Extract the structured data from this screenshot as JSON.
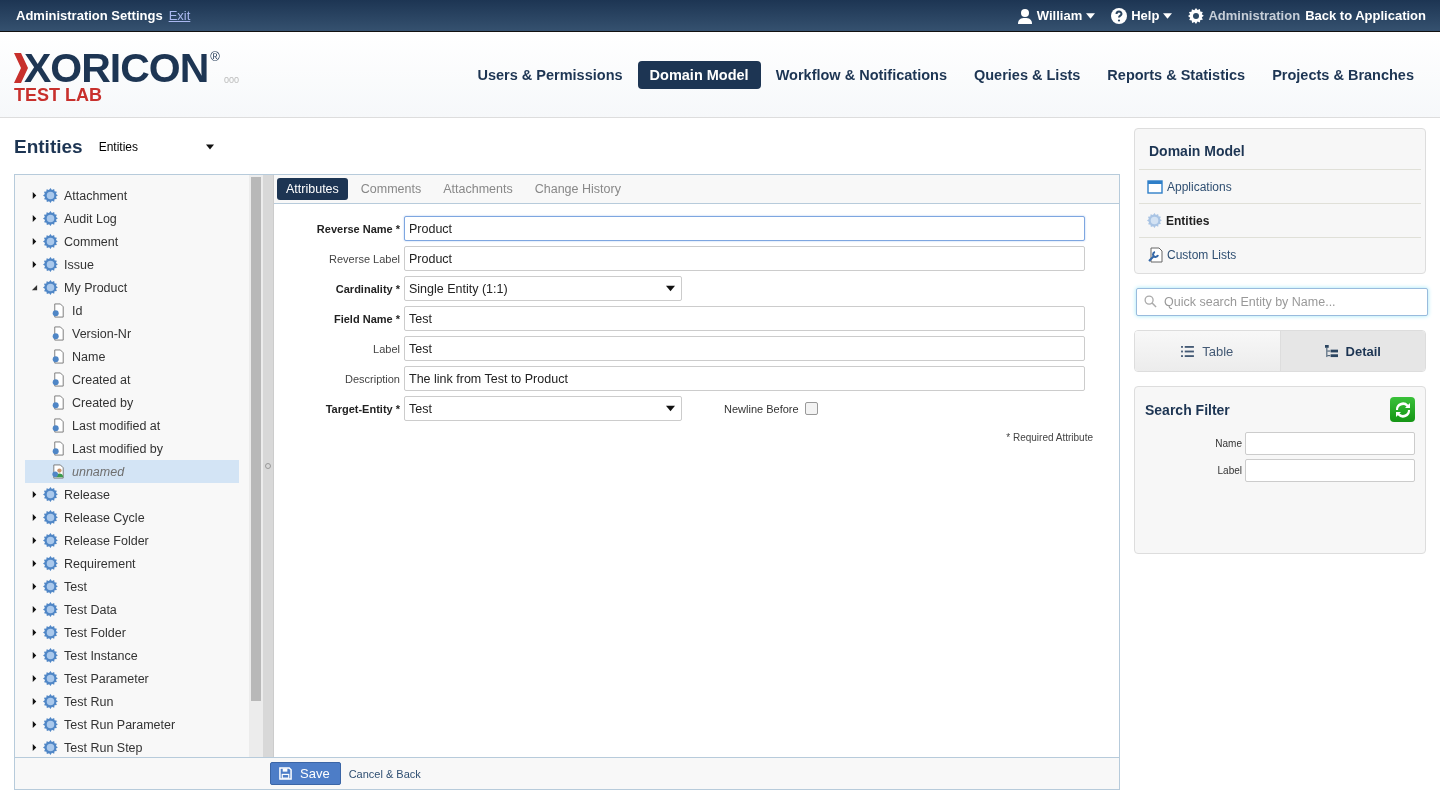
{
  "top_bar": {
    "title": "Administration Settings",
    "exit_link": "Exit",
    "user_menu": "William",
    "help_menu": "Help",
    "admin_label": "Administration",
    "back_link": "Back to Application"
  },
  "logo": {
    "brand": "XORICON",
    "registered": "®",
    "subtitle": "TEST LAB",
    "version": "000"
  },
  "nav": [
    {
      "label": "Users & Permissions",
      "selected": false
    },
    {
      "label": "Domain Model",
      "selected": true
    },
    {
      "label": "Workflow & Notifications",
      "selected": false
    },
    {
      "label": "Queries & Lists",
      "selected": false
    },
    {
      "label": "Reports & Statistics",
      "selected": false
    },
    {
      "label": "Projects & Branches",
      "selected": false
    }
  ],
  "page": {
    "title": "Entities",
    "selector": "Entities"
  },
  "tree": [
    {
      "label": "Attachment",
      "kind": "entity",
      "expanded": false,
      "selected": false
    },
    {
      "label": "Audit Log",
      "kind": "entity",
      "expanded": false,
      "selected": false
    },
    {
      "label": "Comment",
      "kind": "entity",
      "expanded": false,
      "selected": false
    },
    {
      "label": "Issue",
      "kind": "entity",
      "expanded": false,
      "selected": false
    },
    {
      "label": "My Product",
      "kind": "entity",
      "expanded": true,
      "selected": false,
      "children": [
        {
          "label": "Id",
          "kind": "attribute",
          "selected": false
        },
        {
          "label": "Version-Nr",
          "kind": "attribute",
          "selected": false
        },
        {
          "label": "Name",
          "kind": "attribute",
          "selected": false
        },
        {
          "label": "Created at",
          "kind": "attribute",
          "selected": false
        },
        {
          "label": "Created by",
          "kind": "attribute",
          "selected": false
        },
        {
          "label": "Last modified at",
          "kind": "attribute",
          "selected": false
        },
        {
          "label": "Last modified by",
          "kind": "attribute",
          "selected": false
        },
        {
          "label": "unnamed",
          "kind": "link",
          "selected": true
        }
      ]
    },
    {
      "label": "Release",
      "kind": "entity",
      "expanded": false,
      "selected": false
    },
    {
      "label": "Release Cycle",
      "kind": "entity",
      "expanded": false,
      "selected": false
    },
    {
      "label": "Release Folder",
      "kind": "entity",
      "expanded": false,
      "selected": false
    },
    {
      "label": "Requirement",
      "kind": "entity",
      "expanded": false,
      "selected": false
    },
    {
      "label": "Test",
      "kind": "entity",
      "expanded": false,
      "selected": false
    },
    {
      "label": "Test Data",
      "kind": "entity",
      "expanded": false,
      "selected": false
    },
    {
      "label": "Test Folder",
      "kind": "entity",
      "expanded": false,
      "selected": false
    },
    {
      "label": "Test Instance",
      "kind": "entity",
      "expanded": false,
      "selected": false
    },
    {
      "label": "Test Parameter",
      "kind": "entity",
      "expanded": false,
      "selected": false
    },
    {
      "label": "Test Run",
      "kind": "entity",
      "expanded": false,
      "selected": false
    },
    {
      "label": "Test Run Parameter",
      "kind": "entity",
      "expanded": false,
      "selected": false
    },
    {
      "label": "Test Run Step",
      "kind": "entity",
      "expanded": false,
      "selected": false
    }
  ],
  "detail_tabs": [
    {
      "label": "Attributes",
      "selected": true
    },
    {
      "label": "Comments",
      "selected": false
    },
    {
      "label": "Attachments",
      "selected": false
    },
    {
      "label": "Change History",
      "selected": false
    }
  ],
  "form": [
    {
      "label": "Reverse Name *",
      "required": true,
      "kind": "text",
      "value": "Product",
      "focused": true
    },
    {
      "label": "Reverse Label",
      "required": false,
      "kind": "text",
      "value": "Product",
      "focused": false
    },
    {
      "label": "Cardinality *",
      "required": true,
      "kind": "select",
      "value": "Single Entity (1:1)",
      "focused": false
    },
    {
      "label": "Field Name *",
      "required": true,
      "kind": "text",
      "value": "Test",
      "focused": false
    },
    {
      "label": "Label",
      "required": false,
      "kind": "text",
      "value": "Test",
      "focused": false
    },
    {
      "label": "Description",
      "required": false,
      "kind": "text",
      "value": "The link from Test to Product",
      "focused": false
    },
    {
      "label": "Target-Entity *",
      "required": true,
      "kind": "select",
      "value": "Test",
      "focused": false
    }
  ],
  "newline_before": {
    "label": "Newline Before",
    "checked": false
  },
  "required_note": "* Required Attribute",
  "footer": {
    "save": "Save",
    "cancel": "Cancel & Back"
  },
  "sidebar": {
    "title": "Domain Model",
    "items": [
      {
        "label": "Applications",
        "kind": "window",
        "selected": false
      },
      {
        "label": "Entities",
        "kind": "gear",
        "selected": true
      },
      {
        "label": "Custom Lists",
        "kind": "wrench",
        "selected": false
      }
    ]
  },
  "quick_search": {
    "placeholder": "Quick search Entity by Name..."
  },
  "view_toggle": [
    {
      "label": "Table",
      "kind": "list",
      "selected": false
    },
    {
      "label": "Detail",
      "kind": "tree",
      "selected": true
    }
  ],
  "search_filter": {
    "title": "Search Filter",
    "fields": [
      {
        "label": "Name"
      },
      {
        "label": "Label"
      }
    ]
  }
}
